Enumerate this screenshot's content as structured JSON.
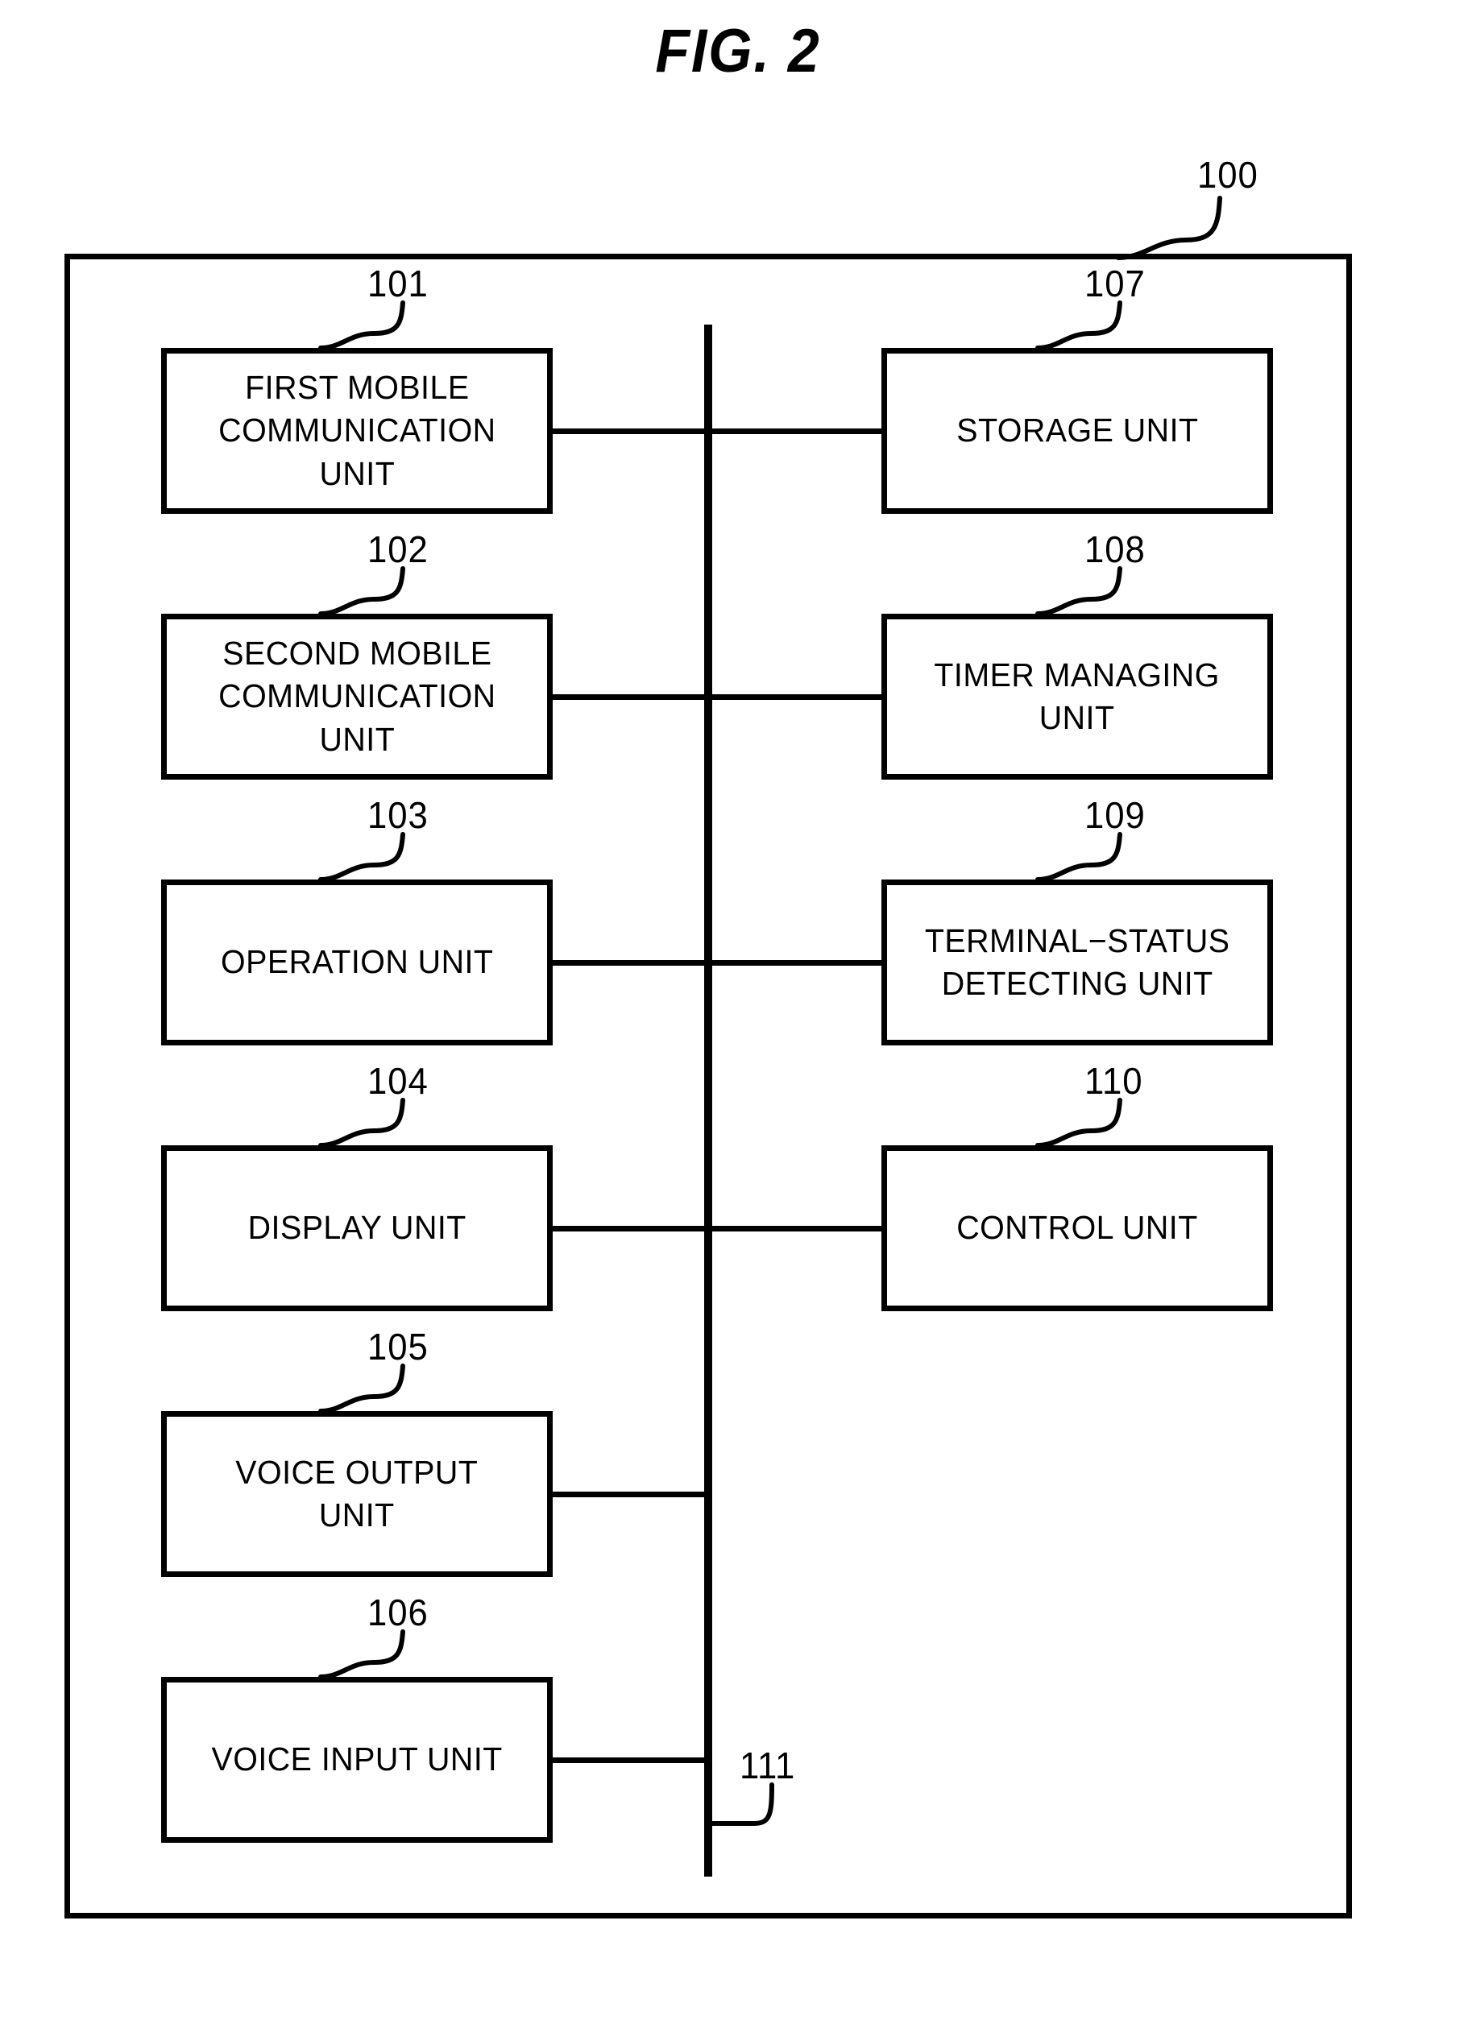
{
  "figure": {
    "title": "FIG. 2",
    "device_ref": "100",
    "bus_ref": "111"
  },
  "units": [
    {
      "ref": "101",
      "label": "FIRST MOBILE\nCOMMUNICATION\nUNIT",
      "column": "left"
    },
    {
      "ref": "102",
      "label": "SECOND MOBILE\nCOMMUNICATION\nUNIT",
      "column": "left"
    },
    {
      "ref": "103",
      "label": "OPERATION UNIT",
      "column": "left"
    },
    {
      "ref": "104",
      "label": "DISPLAY UNIT",
      "column": "left"
    },
    {
      "ref": "105",
      "label": "VOICE OUTPUT\nUNIT",
      "column": "left"
    },
    {
      "ref": "106",
      "label": "VOICE INPUT UNIT",
      "column": "left"
    },
    {
      "ref": "107",
      "label": "STORAGE UNIT",
      "column": "right"
    },
    {
      "ref": "108",
      "label": "TIMER MANAGING\nUNIT",
      "column": "right"
    },
    {
      "ref": "109",
      "label": "TERMINAL−STATUS\nDETECTING UNIT",
      "column": "right"
    },
    {
      "ref": "110",
      "label": "CONTROL UNIT",
      "column": "right"
    }
  ]
}
